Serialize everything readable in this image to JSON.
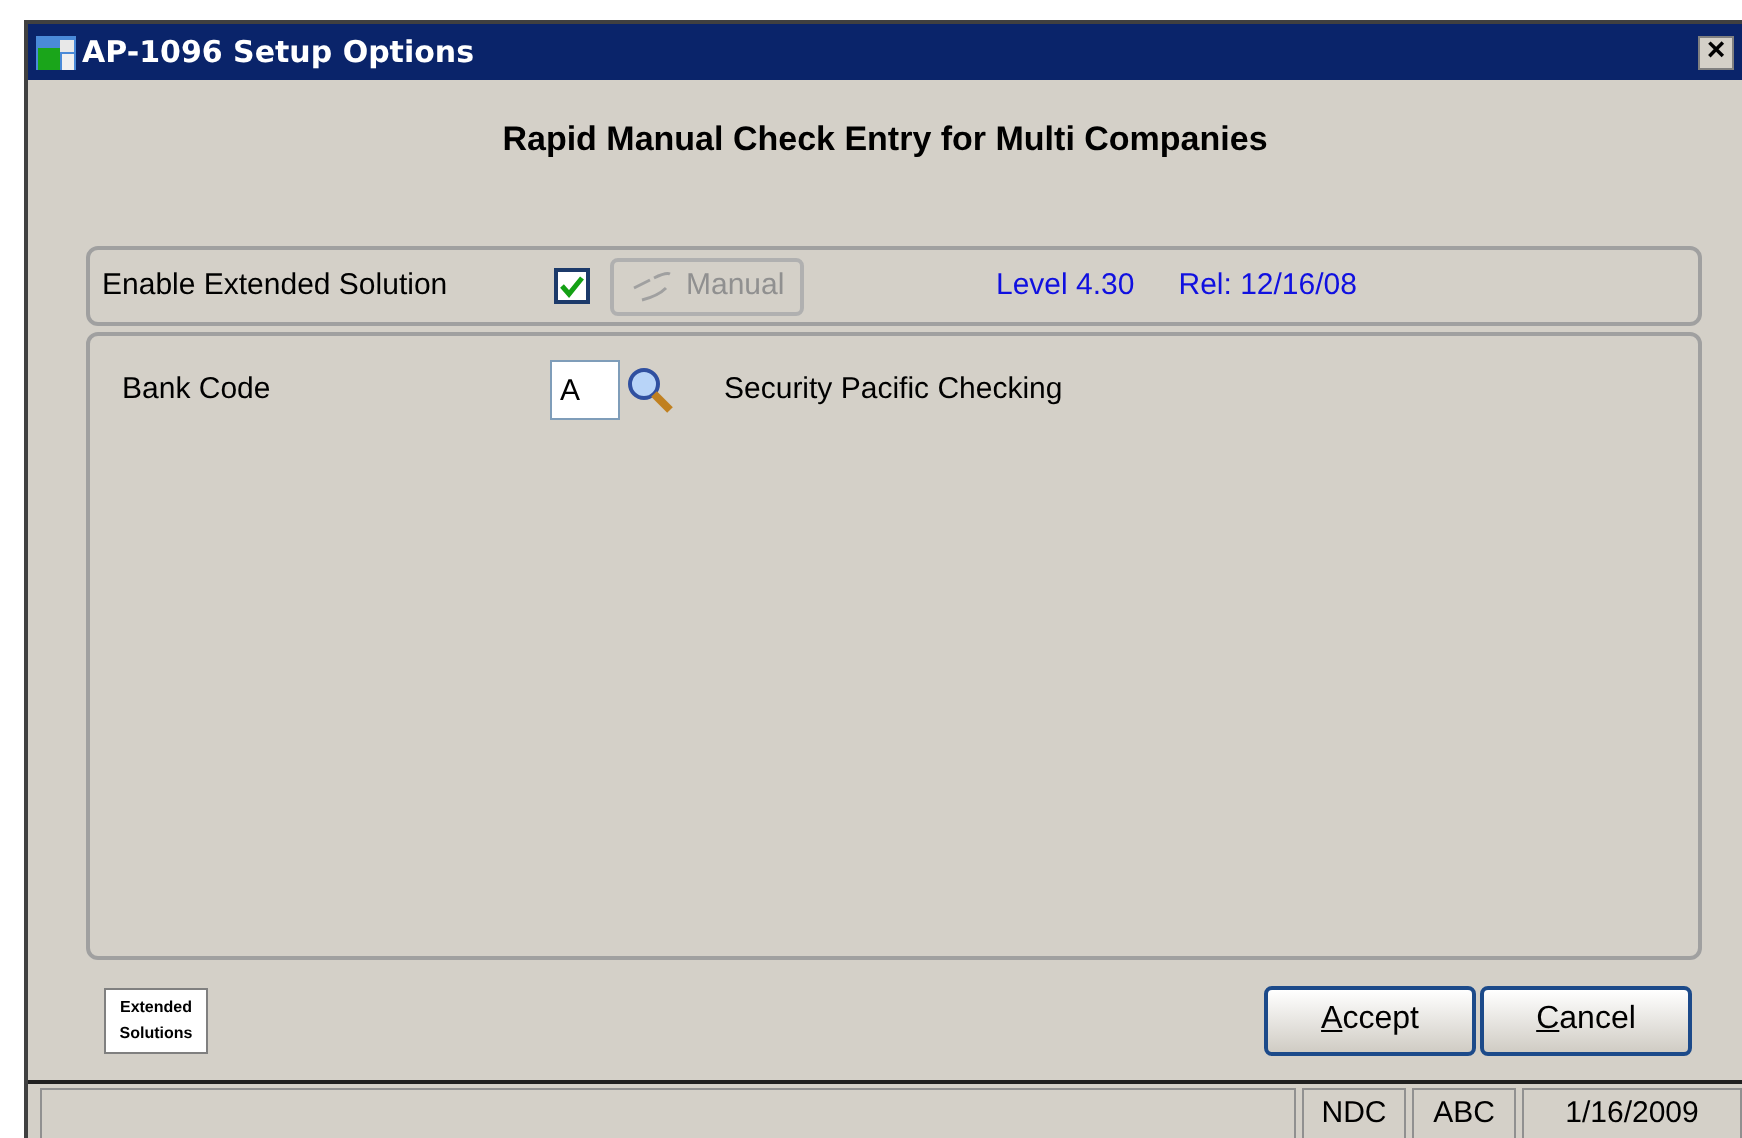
{
  "window": {
    "title": "AP-1096 Setup Options",
    "close": "×"
  },
  "heading": "Rapid Manual Check Entry for Multi Companies",
  "options": {
    "enable_label": "Enable Extended Solution",
    "enable_checked": true,
    "manual_button": {
      "label": "Manual",
      "disabled": true
    },
    "level": "Level 4.30",
    "release": "Rel: 12/16/08"
  },
  "bank": {
    "label": "Bank Code",
    "value": "A",
    "description": "Security Pacific Checking"
  },
  "logo": {
    "line1": "Extended",
    "line2": "Solutions"
  },
  "buttons": [
    {
      "label": "Accept",
      "first_letter_underlined": true
    },
    {
      "label": "Cancel",
      "first_letter_underlined": true
    }
  ],
  "status_bar": [
    "NDC",
    "ABC",
    "1/16/2009"
  ]
}
